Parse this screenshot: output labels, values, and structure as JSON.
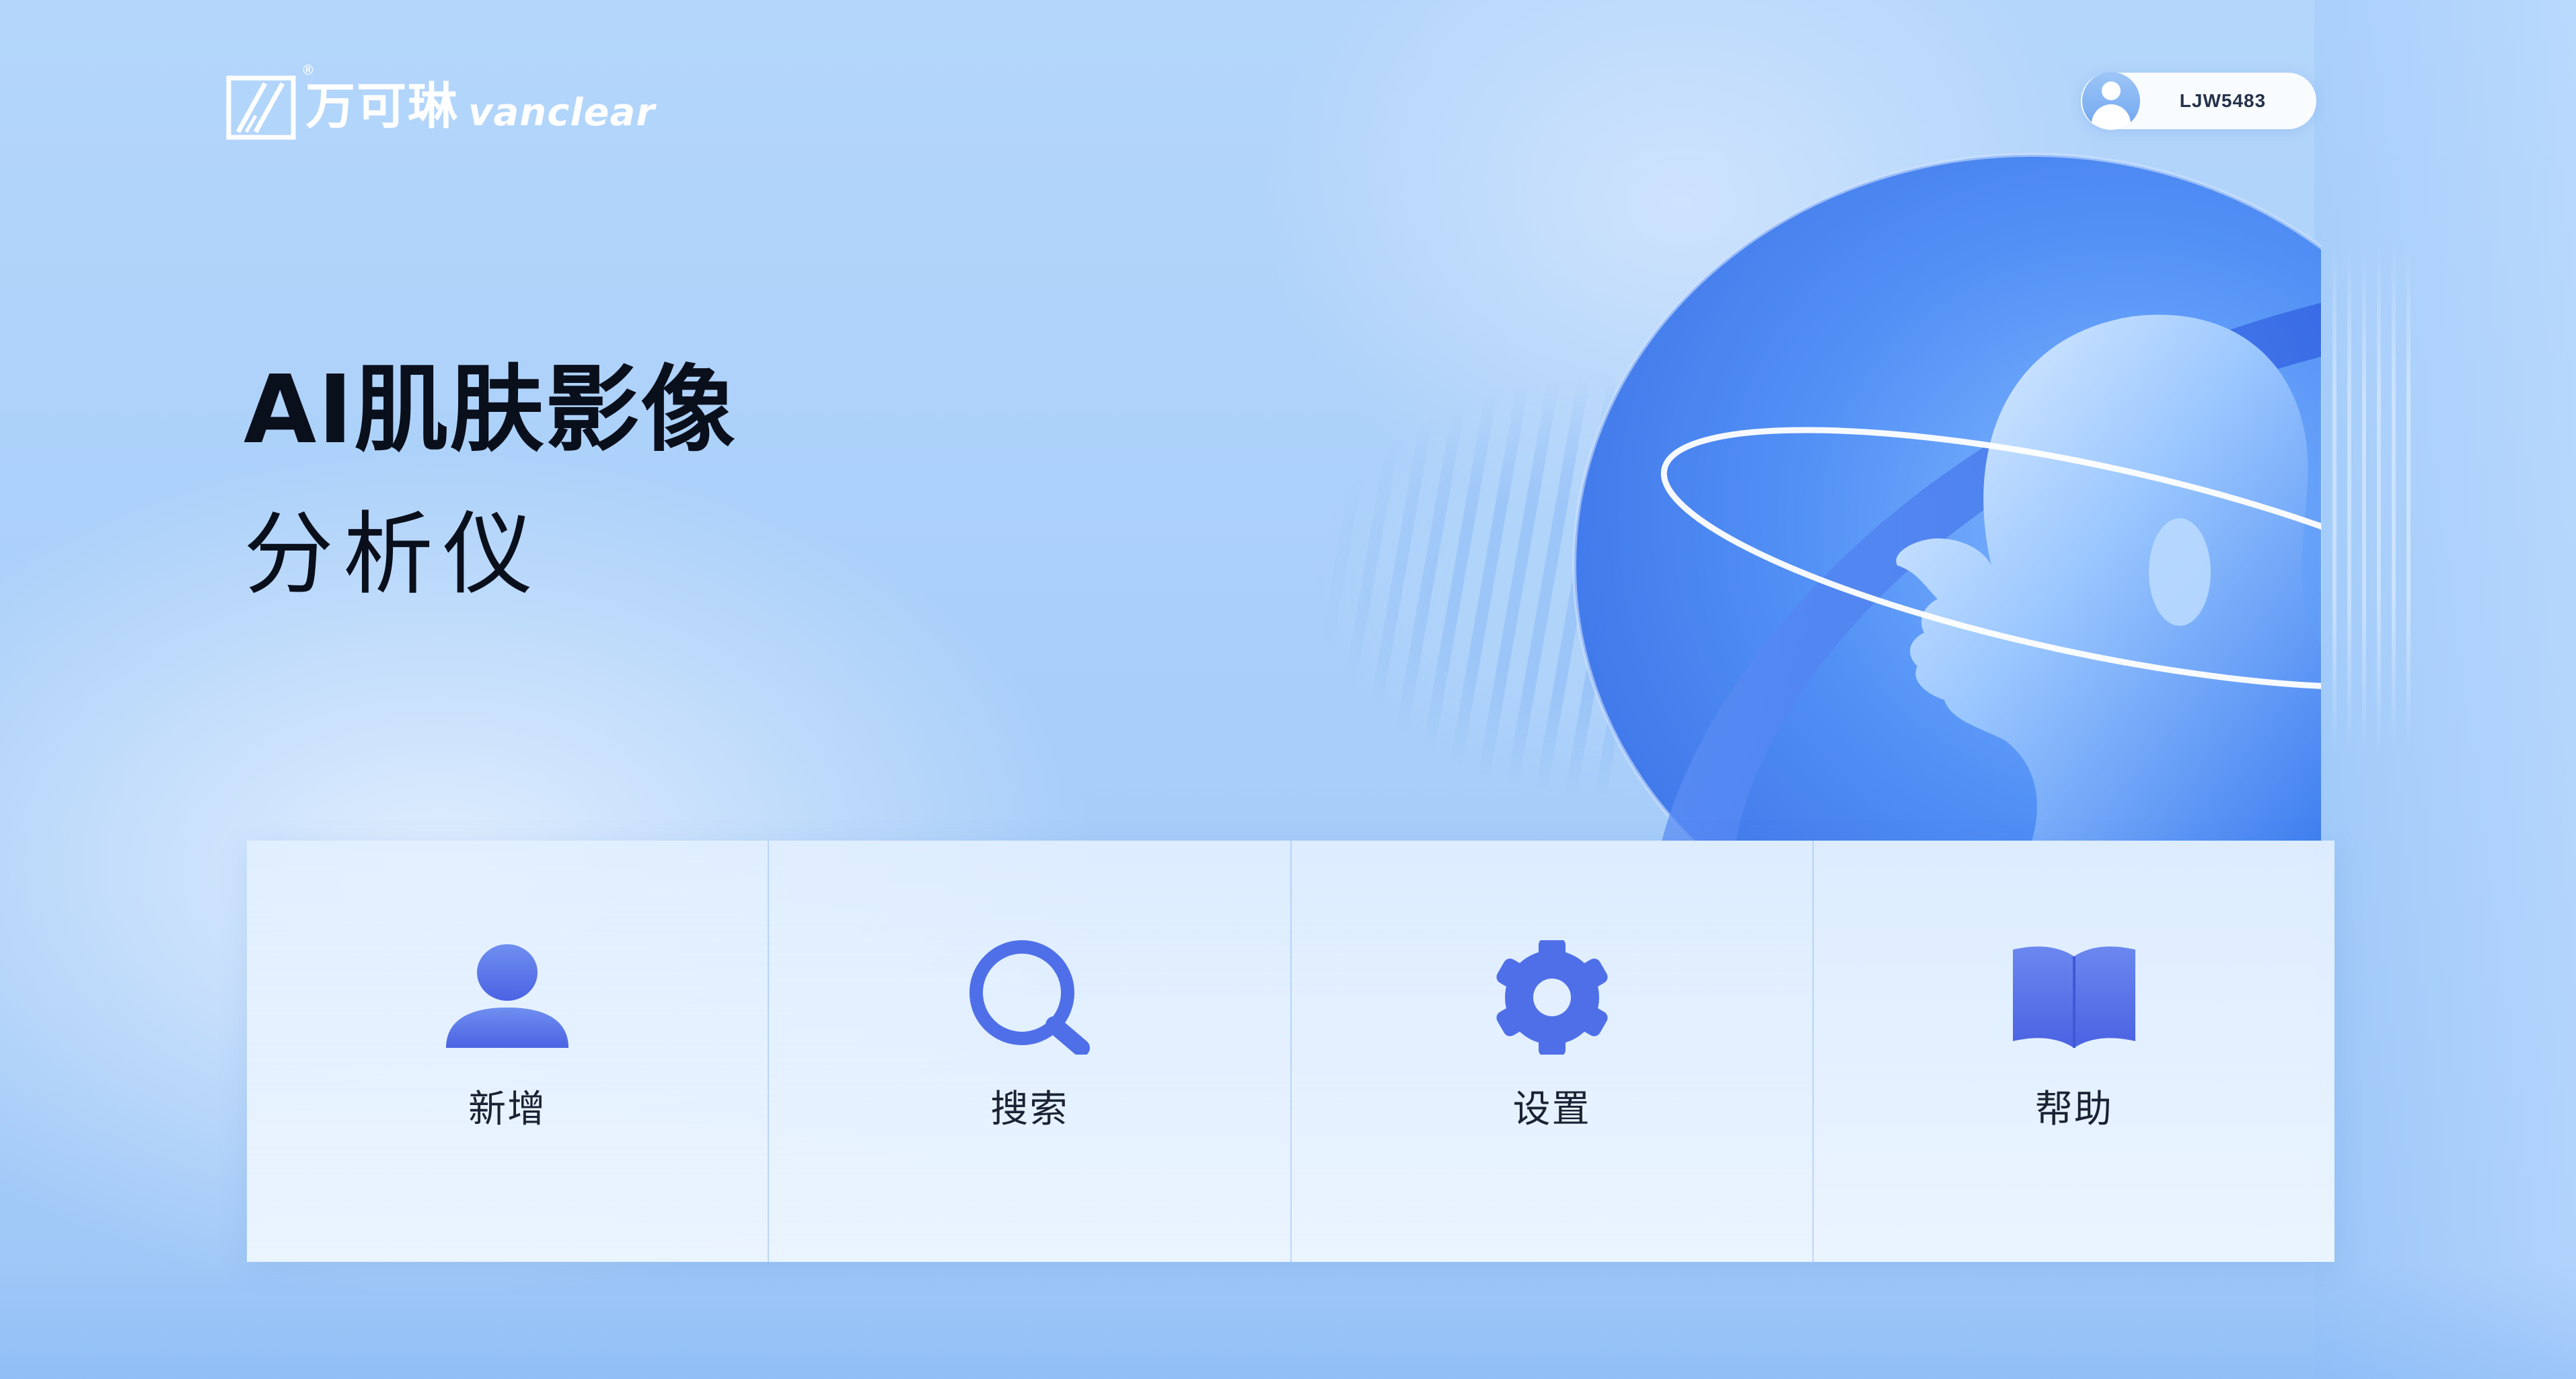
{
  "brand": {
    "logo_cn": "万可琳",
    "logo_en": "vanclear",
    "registered_mark": "®"
  },
  "user": {
    "name": "LJW5483",
    "avatar_icon": "user-avatar-icon"
  },
  "title": {
    "main": "AI肌肤影像",
    "sub": "分析仪"
  },
  "menu": {
    "items": [
      {
        "label": "新增",
        "icon": "add-person-icon"
      },
      {
        "label": "搜索",
        "icon": "search-icon"
      },
      {
        "label": "设置",
        "icon": "gear-icon"
      },
      {
        "label": "帮助",
        "icon": "book-icon"
      }
    ]
  },
  "colors": {
    "accent": "#4f6fe8",
    "background": "#b4d6fb",
    "text": "#0a0f1c"
  }
}
